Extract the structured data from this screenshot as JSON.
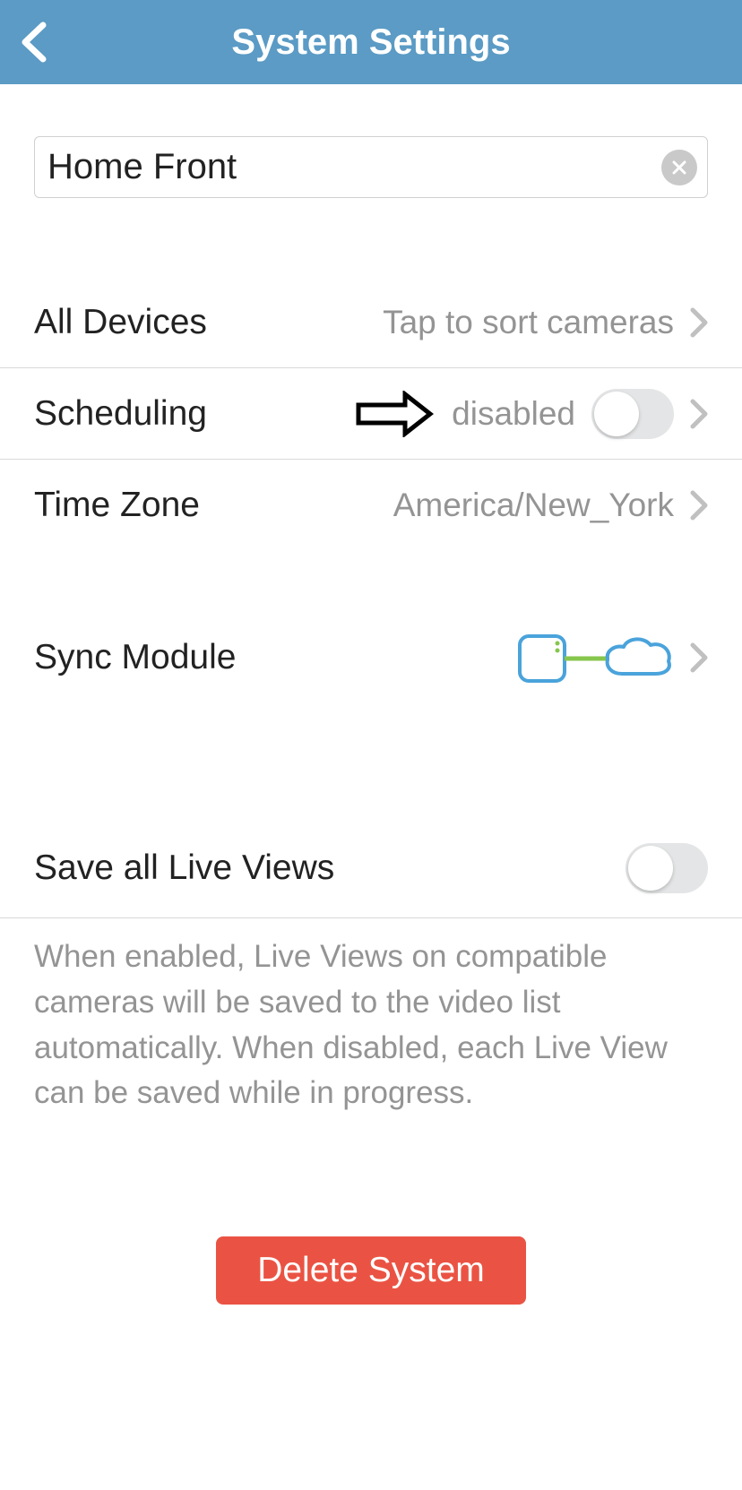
{
  "header": {
    "title": "System Settings"
  },
  "systemName": {
    "value": "Home Front"
  },
  "rows": {
    "allDevices": {
      "label": "All Devices",
      "value": "Tap to sort cameras"
    },
    "scheduling": {
      "label": "Scheduling",
      "value": "disabled",
      "toggle": false
    },
    "timezone": {
      "label": "Time Zone",
      "value": "America/New_York"
    },
    "syncModule": {
      "label": "Sync Module"
    },
    "liveViews": {
      "label": "Save all Live Views",
      "toggle": false,
      "description": "When enabled, Live Views on compatible cameras will be saved to the video list automatically. When disabled, each Live View can be saved while in progress."
    }
  },
  "deleteButton": {
    "label": "Delete System"
  }
}
